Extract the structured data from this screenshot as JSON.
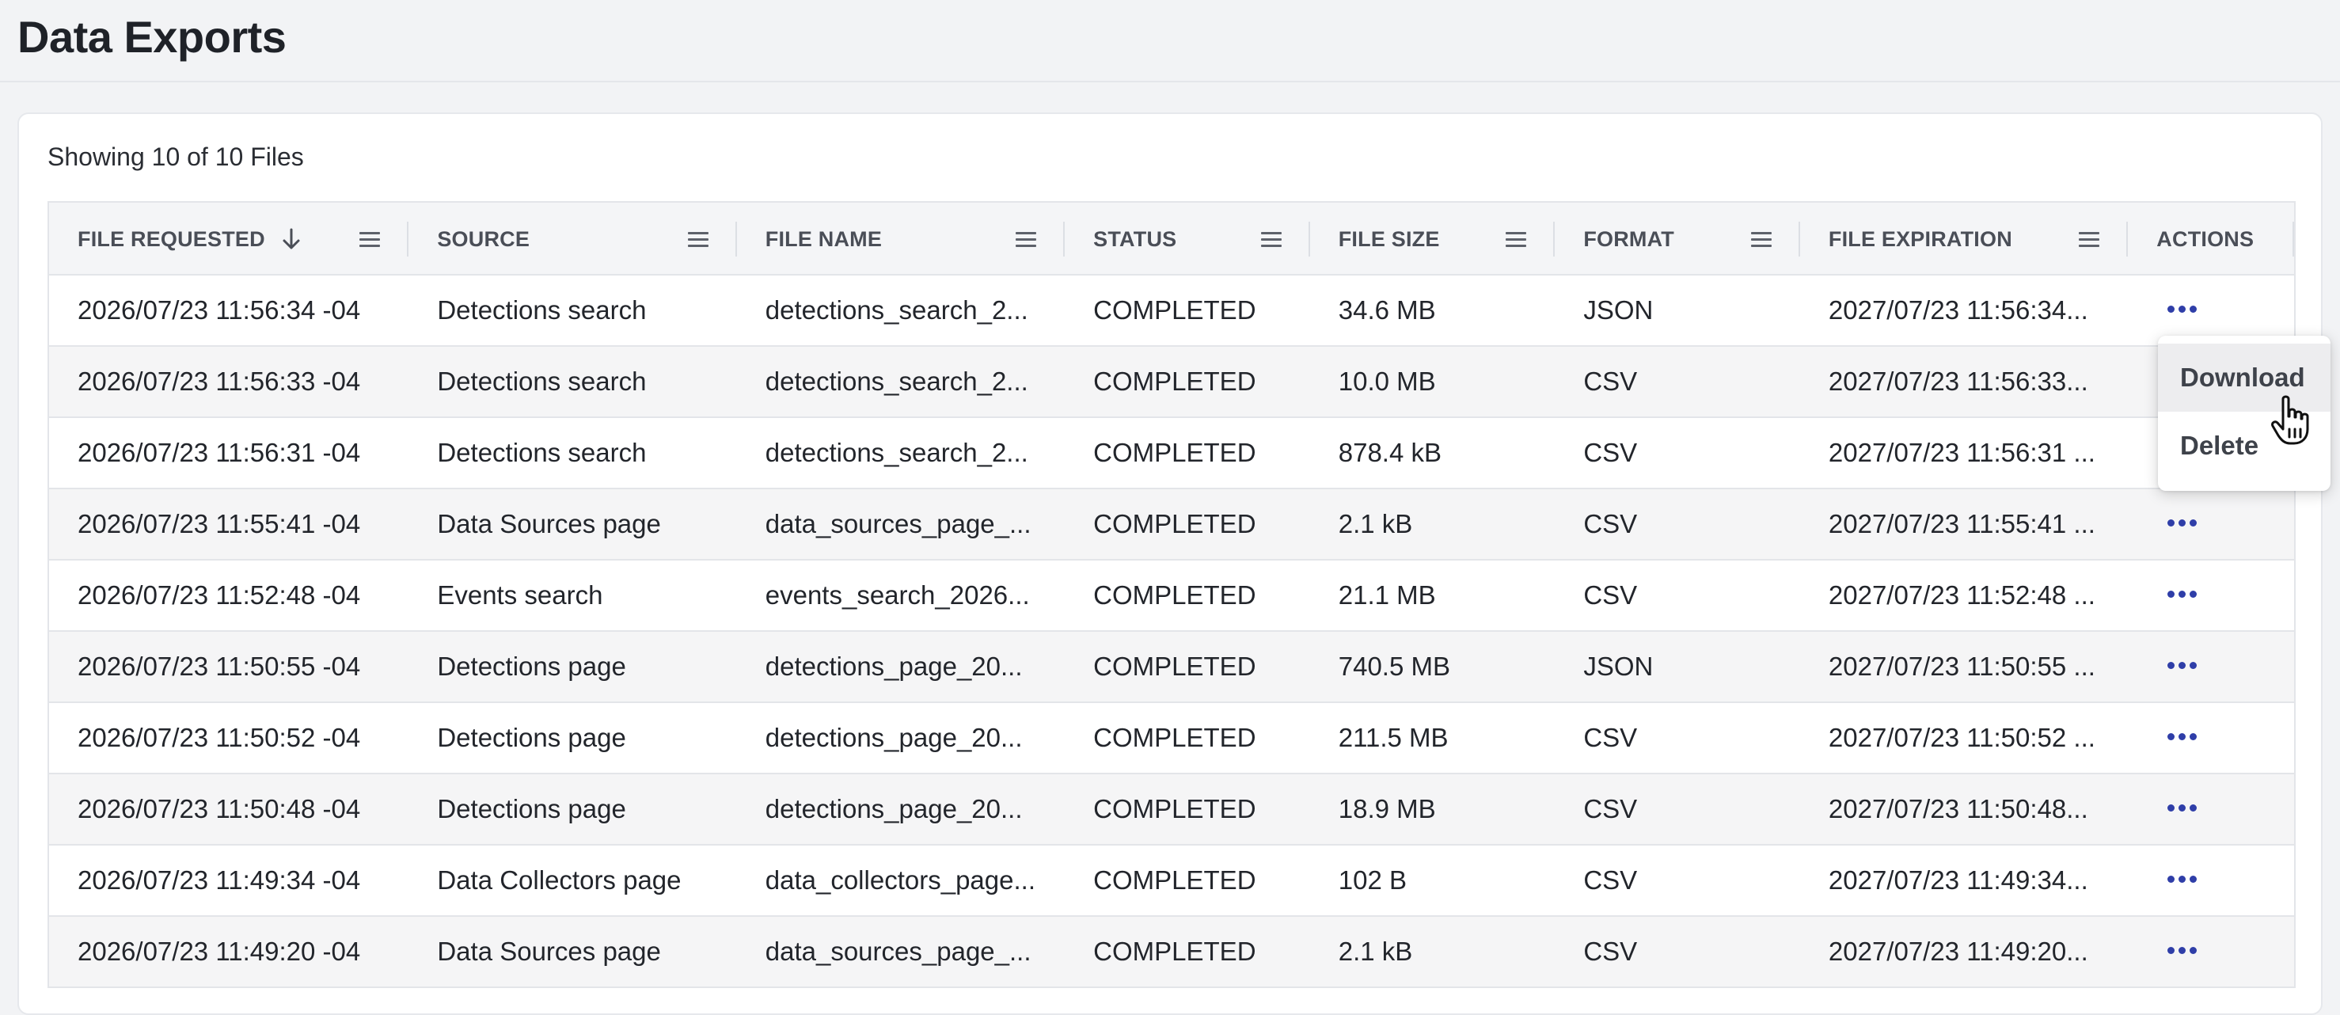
{
  "page": {
    "title": "Data Exports"
  },
  "summary": {
    "showing": "Showing 10 of 10 Files"
  },
  "columns": [
    {
      "key": "requested",
      "label": "FILE REQUESTED"
    },
    {
      "key": "source",
      "label": "SOURCE"
    },
    {
      "key": "name",
      "label": "FILE NAME"
    },
    {
      "key": "status",
      "label": "STATUS"
    },
    {
      "key": "size",
      "label": "FILE SIZE"
    },
    {
      "key": "format",
      "label": "FORMAT"
    },
    {
      "key": "expiration",
      "label": "FILE EXPIRATION"
    },
    {
      "key": "actions",
      "label": "ACTIONS"
    }
  ],
  "rows": [
    {
      "requested": "2026/07/23 11:56:34 -04",
      "source": "Detections search",
      "name": "detections_search_2...",
      "status": "COMPLETED",
      "size": "34.6 MB",
      "format": "JSON",
      "expiration": "2027/07/23 11:56:34..."
    },
    {
      "requested": "2026/07/23 11:56:33 -04",
      "source": "Detections search",
      "name": "detections_search_2...",
      "status": "COMPLETED",
      "size": "10.0 MB",
      "format": "CSV",
      "expiration": "2027/07/23 11:56:33..."
    },
    {
      "requested": "2026/07/23 11:56:31 -04",
      "source": "Detections search",
      "name": "detections_search_2...",
      "status": "COMPLETED",
      "size": "878.4 kB",
      "format": "CSV",
      "expiration": "2027/07/23 11:56:31 ..."
    },
    {
      "requested": "2026/07/23 11:55:41 -04",
      "source": "Data Sources page",
      "name": "data_sources_page_...",
      "status": "COMPLETED",
      "size": "2.1 kB",
      "format": "CSV",
      "expiration": "2027/07/23 11:55:41 ..."
    },
    {
      "requested": "2026/07/23 11:52:48 -04",
      "source": "Events search",
      "name": "events_search_2026...",
      "status": "COMPLETED",
      "size": "21.1 MB",
      "format": "CSV",
      "expiration": "2027/07/23 11:52:48 ..."
    },
    {
      "requested": "2026/07/23 11:50:55 -04",
      "source": "Detections page",
      "name": "detections_page_20...",
      "status": "COMPLETED",
      "size": "740.5 MB",
      "format": "JSON",
      "expiration": "2027/07/23 11:50:55 ..."
    },
    {
      "requested": "2026/07/23 11:50:52 -04",
      "source": "Detections page",
      "name": "detections_page_20...",
      "status": "COMPLETED",
      "size": "211.5 MB",
      "format": "CSV",
      "expiration": "2027/07/23 11:50:52 ..."
    },
    {
      "requested": "2026/07/23 11:50:48 -04",
      "source": "Detections page",
      "name": "detections_page_20...",
      "status": "COMPLETED",
      "size": "18.9 MB",
      "format": "CSV",
      "expiration": "2027/07/23 11:50:48..."
    },
    {
      "requested": "2026/07/23 11:49:34 -04",
      "source": "Data Collectors page",
      "name": "data_collectors_page...",
      "status": "COMPLETED",
      "size": "102 B",
      "format": "CSV",
      "expiration": "2027/07/23 11:49:34..."
    },
    {
      "requested": "2026/07/23 11:49:20 -04",
      "source": "Data Sources page",
      "name": "data_sources_page_...",
      "status": "COMPLETED",
      "size": "2.1 kB",
      "format": "CSV",
      "expiration": "2027/07/23 11:49:20..."
    }
  ],
  "menu": {
    "items": [
      {
        "label": "Download",
        "hover": true
      },
      {
        "label": "Delete",
        "hover": false
      }
    ]
  },
  "icons": {
    "sort": "arrow-down-icon",
    "column_menu": "column-menu-icon",
    "row_actions": "more-horizontal-icon",
    "cursor": "hand-pointer-icon"
  },
  "colors": {
    "accent": "#2f3ea8",
    "row_alt": "#f5f5f6",
    "header_bg": "#f4f5f7"
  }
}
